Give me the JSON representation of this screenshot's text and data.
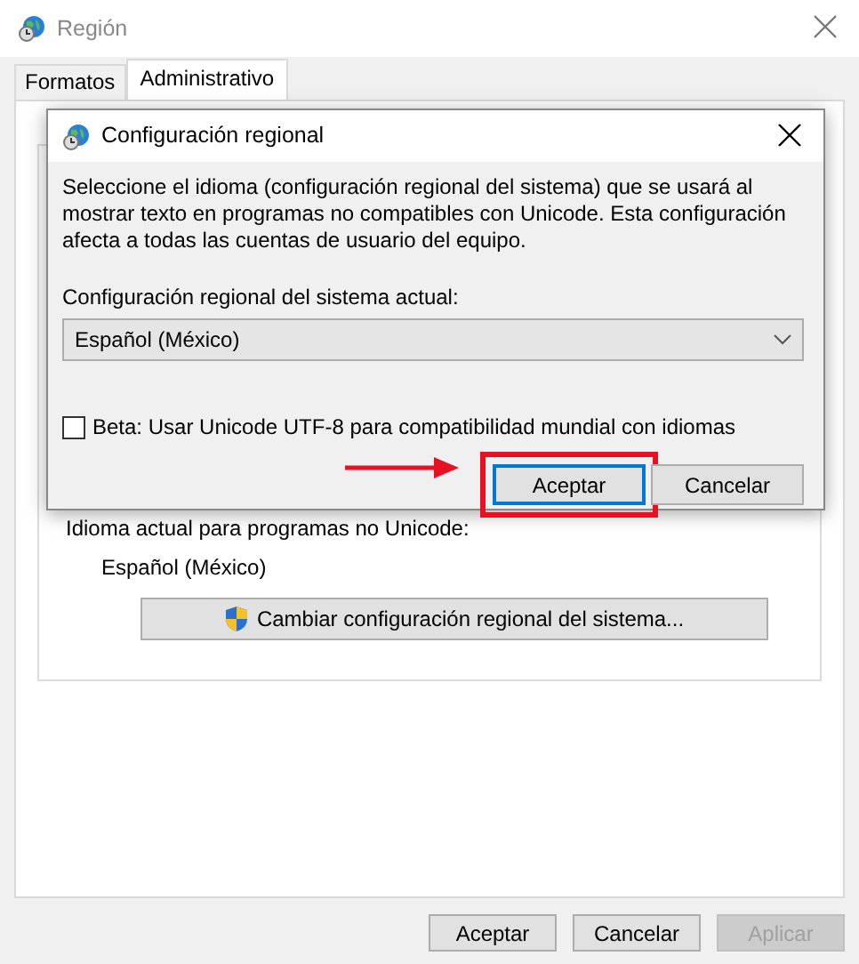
{
  "window": {
    "title": "Región"
  },
  "tabs": [
    {
      "label": "Formatos",
      "selected": false
    },
    {
      "label": "Administrativo",
      "selected": true
    }
  ],
  "panel": {
    "section_label": "Idioma actual para programas no Unicode:",
    "current_locale": "Español (México)",
    "change_button": "Cambiar configuración regional del sistema..."
  },
  "buttons": [
    {
      "label": "Aceptar",
      "disabled": false
    },
    {
      "label": "Cancelar",
      "disabled": false
    },
    {
      "label": "Aplicar",
      "disabled": true
    }
  ],
  "dialog": {
    "title": "Configuración regional",
    "description": "Seleccione el idioma (configuración regional del sistema) que se usará al mostrar texto en programas no compatibles con Unicode. Esta configuración afecta a todas las cuentas de usuario del equipo.",
    "locale_label": "Configuración regional del sistema actual:",
    "locale_value": "Español (México)",
    "beta": {
      "label": "Beta: Usar Unicode UTF-8 para compatibilidad mundial con idiomas",
      "checked": false
    },
    "buttons": [
      {
        "label": "Aceptar",
        "default": true,
        "highlighted": true
      },
      {
        "label": "Cancelar",
        "default": false,
        "highlighted": false
      }
    ]
  }
}
